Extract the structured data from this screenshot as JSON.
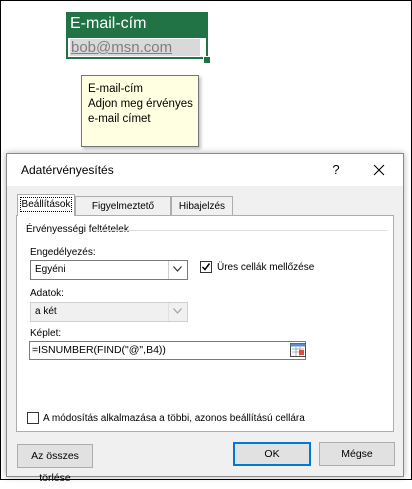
{
  "sheet": {
    "header_cell": "E-mail-cím",
    "email_cell": "bob@msn.com"
  },
  "tooltip": {
    "title": "E-mail-cím",
    "message": "Adjon meg érvényes e-mail címet"
  },
  "dialog": {
    "title": "Adatérvényesítés",
    "help": "?",
    "tabs": [
      "Beállítások",
      "Figyelmeztető üzenet",
      "Hibajelzés"
    ],
    "group_label": "Érvényességi feltételek",
    "allow_label": "Engedélyezés:",
    "allow_value": "Egyéni",
    "ignore_blank_label": "Üres cellák mellőzése",
    "ignore_blank_checked": true,
    "data_label": "Adatok:",
    "data_value": "a két",
    "formula_label": "Képlet:",
    "formula_value": "=ISNUMBER(FIND(\"@\",B4))",
    "apply_all_label": "A módosítás alkalmazása a többi, azonos beállítású cellára",
    "apply_all_checked": false,
    "clear_all": "Az összes törlése",
    "ok": "OK",
    "cancel": "Mégse"
  },
  "colors": {
    "header_green": "#217346",
    "tooltip_bg": "#ffffe1",
    "default_button_border": "#0078d7"
  }
}
